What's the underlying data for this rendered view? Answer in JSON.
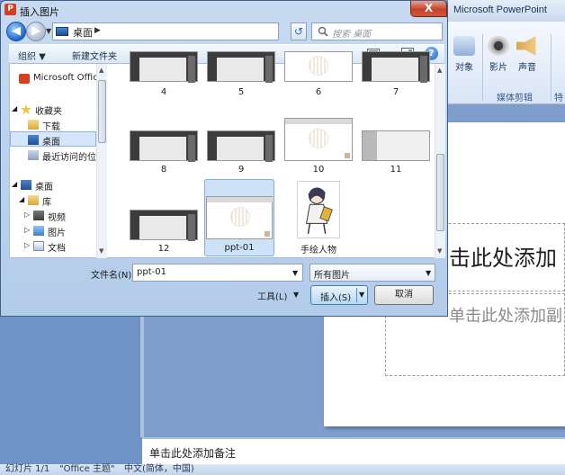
{
  "dialog": {
    "title": "插入图片",
    "close_glyph": "X",
    "address": "桌面",
    "search_placeholder": "搜索 桌面",
    "toolbar": {
      "organize": "组织 ▼",
      "new_folder": "新建文件夹"
    },
    "nav_items": [
      {
        "label": "Microsoft Office"
      },
      {
        "label": "收藏夹"
      },
      {
        "label": "下载"
      },
      {
        "label": "桌面"
      },
      {
        "label": "最近访问的位置"
      },
      {
        "label": "桌面"
      },
      {
        "label": "库"
      },
      {
        "label": "视频"
      },
      {
        "label": "图片"
      },
      {
        "label": "文档"
      }
    ],
    "files": [
      {
        "label": "4"
      },
      {
        "label": "5"
      },
      {
        "label": "6"
      },
      {
        "label": "7"
      },
      {
        "label": "8"
      },
      {
        "label": "9"
      },
      {
        "label": "10"
      },
      {
        "label": "11"
      },
      {
        "label": "12"
      },
      {
        "label": "ppt-01"
      },
      {
        "label": "手绘人物"
      }
    ],
    "filename_label": "文件名(N):",
    "filename_value": "ppt-01",
    "filetype_value": "所有图片",
    "tools_label": "工具(L)",
    "insert_label": "插入(S)",
    "cancel_label": "取消"
  },
  "ppt": {
    "title": "Microsoft PowerPoint",
    "ribbon": {
      "object": "对象",
      "movie": "影片",
      "sound": "声音",
      "group_media": "媒体剪辑",
      "group_special": "特"
    },
    "title_placeholder": "击此处添加",
    "subtitle_placeholder": "单击此处添加副",
    "notes_placeholder": "单击此处添加备注",
    "status": {
      "slide": "幻灯片 1/1",
      "theme": "\"Office 主题\"",
      "language": "中文(简体，中国)"
    }
  }
}
